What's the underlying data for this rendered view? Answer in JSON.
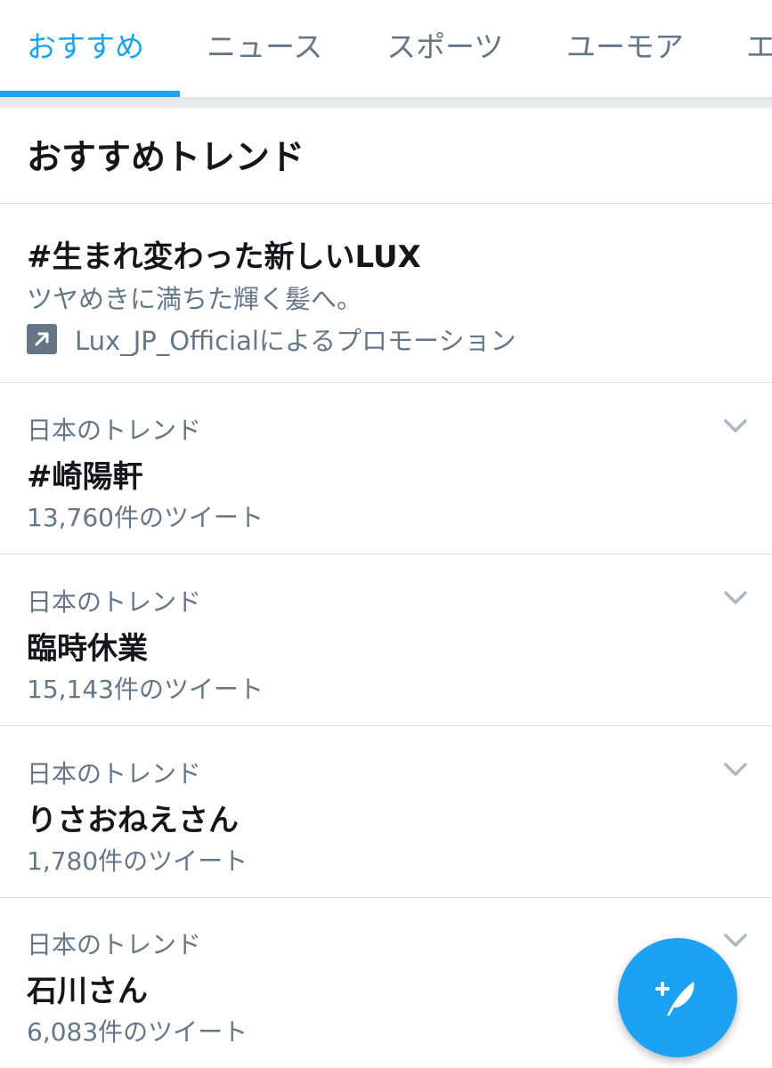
{
  "tabs": [
    {
      "label": "おすすめ",
      "active": true
    },
    {
      "label": "ニュース",
      "active": false
    },
    {
      "label": "スポーツ",
      "active": false
    },
    {
      "label": "ユーモア",
      "active": false
    },
    {
      "label": "エ",
      "active": false
    }
  ],
  "section": {
    "title": "おすすめトレンド"
  },
  "promoted": {
    "title": "#生まれ変わった新しいLUX",
    "description": "ツヤめきに満ちた輝く髪へ。",
    "promoted_by": "Lux_JP_Officialによるプロモーション",
    "icon": "promoted-arrow-icon"
  },
  "trends": [
    {
      "context": "日本のトレンド",
      "name": "#崎陽軒",
      "count": "13,760件のツイート"
    },
    {
      "context": "日本のトレンド",
      "name": "臨時休業",
      "count": "15,143件のツイート"
    },
    {
      "context": "日本のトレンド",
      "name": "りさおねえさん",
      "count": "1,780件のツイート"
    },
    {
      "context": "日本のトレンド",
      "name": "石川さん",
      "count": "6,083件のツイート"
    }
  ],
  "fab": {
    "icon": "compose-tweet-icon"
  },
  "colors": {
    "accent": "#1da1f2",
    "text_primary": "#14171a",
    "text_secondary": "#657786",
    "divider": "#d9e1e8"
  }
}
